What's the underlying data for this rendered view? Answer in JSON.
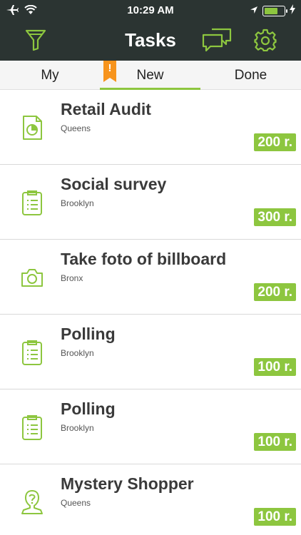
{
  "status_bar": {
    "time": "10:29 AM",
    "battery_level": 0.7
  },
  "nav": {
    "title": "Tasks",
    "left_icon": "filter-icon",
    "right_icons": [
      "chat-icon",
      "gear-icon"
    ]
  },
  "tabs": [
    {
      "label": "My",
      "active": false
    },
    {
      "label": "New",
      "active": true,
      "badge": "!"
    },
    {
      "label": "Done",
      "active": false
    }
  ],
  "tasks": [
    {
      "title": "Retail Audit",
      "location": "Queens",
      "price": "200 r.",
      "icon": "report-icon"
    },
    {
      "title": "Social survey",
      "location": "Brooklyn",
      "price": "300 r.",
      "icon": "clipboard-icon"
    },
    {
      "title": "Take foto of billboard",
      "location": "Bronx",
      "price": "200 r.",
      "icon": "camera-icon"
    },
    {
      "title": "Polling",
      "location": "Brooklyn",
      "price": "100 r.",
      "icon": "clipboard-icon"
    },
    {
      "title": "Polling",
      "location": "Brooklyn",
      "price": "100 r.",
      "icon": "clipboard-icon"
    },
    {
      "title": "Mystery Shopper",
      "location": "Queens",
      "price": "100 r.",
      "icon": "mystery-person-icon"
    }
  ],
  "colors": {
    "accent": "#8dc63f",
    "header_bg": "#2b3432",
    "badge": "#f7941d"
  }
}
